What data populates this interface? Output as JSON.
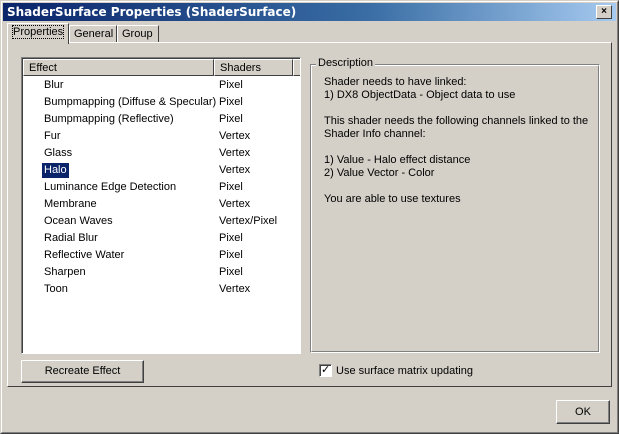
{
  "window": {
    "title": "ShaderSurface Properties (ShaderSurface)",
    "close_label": "×"
  },
  "tabs": [
    {
      "label": "Properties",
      "active": true
    },
    {
      "label": "General",
      "active": false
    },
    {
      "label": "Group",
      "active": false
    }
  ],
  "effects_list": {
    "columns": {
      "effect": "Effect",
      "shaders": "Shaders"
    },
    "rows": [
      {
        "effect": "Blur",
        "shaders": "Pixel"
      },
      {
        "effect": "Bumpmapping (Diffuse & Specular)",
        "shaders": "Pixel"
      },
      {
        "effect": "Bumpmapping (Reflective)",
        "shaders": "Pixel"
      },
      {
        "effect": "Fur",
        "shaders": "Vertex"
      },
      {
        "effect": "Glass",
        "shaders": "Vertex"
      },
      {
        "effect": "Halo",
        "shaders": "Vertex",
        "selected": true
      },
      {
        "effect": "Luminance Edge Detection",
        "shaders": "Pixel"
      },
      {
        "effect": "Membrane",
        "shaders": "Vertex"
      },
      {
        "effect": "Ocean Waves",
        "shaders": "Vertex/Pixel"
      },
      {
        "effect": "Radial Blur",
        "shaders": "Pixel"
      },
      {
        "effect": "Reflective Water",
        "shaders": "Pixel"
      },
      {
        "effect": "Sharpen",
        "shaders": "Pixel"
      },
      {
        "effect": "Toon",
        "shaders": "Vertex"
      }
    ]
  },
  "description": {
    "legend": "Description",
    "line1": "Shader needs to have linked:",
    "line2": "1) DX8 ObjectData - Object data to use",
    "line3": "This shader needs the following channels linked to the Shader Info channel:",
    "line4": "1) Value - Halo effect distance",
    "line5": "2) Value Vector - Color",
    "line6": "You are able to use textures"
  },
  "buttons": {
    "recreate": "Recreate Effect",
    "ok": "OK"
  },
  "checkbox": {
    "label": "Use surface matrix updating",
    "checked": true,
    "mark": "✓"
  }
}
